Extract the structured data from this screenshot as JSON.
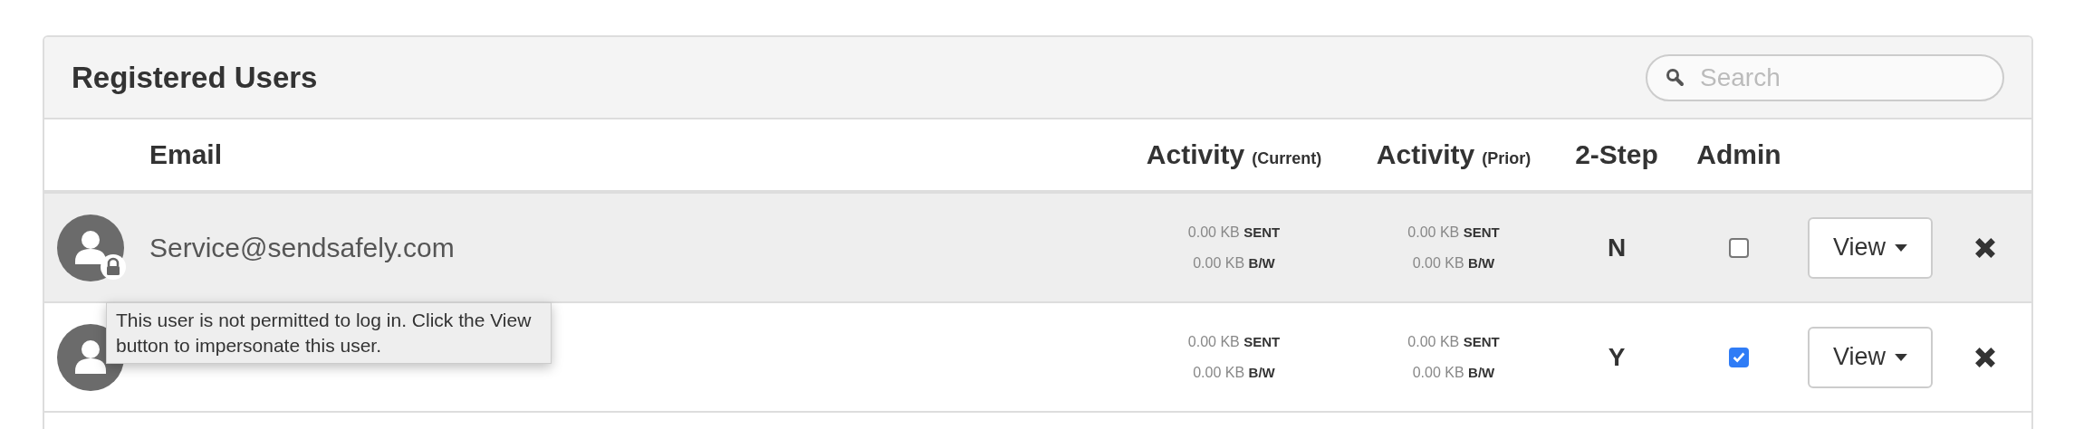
{
  "panel": {
    "title": "Registered Users",
    "search": {
      "placeholder": "Search"
    }
  },
  "columns": [
    {
      "label": "Email"
    },
    {
      "label": "Activity",
      "note": "(Current)"
    },
    {
      "label": "Activity",
      "note": "(Prior)"
    },
    {
      "label": "2-Step"
    },
    {
      "label": "Admin"
    }
  ],
  "users": [
    {
      "email": "Service@sendsafely.com",
      "locked": true,
      "highlighted": true,
      "current": [
        "0.00 KB **SENT**",
        "0.00 KB **B/W**"
      ],
      "prior": [
        "0.00 KB **SENT**",
        "0.00 KB **B/W**"
      ],
      "two_step": "N",
      "admin": false,
      "view_button": "View"
    },
    {
      "locked": false,
      "highlighted": false,
      "current": [
        "0.00 KB **SENT**",
        "0.00 KB **B/W**"
      ],
      "prior": [
        "0.00 KB **SENT**",
        "0.00 KB **B/W**"
      ],
      "two_step": "Y",
      "admin": true,
      "view_button": "View"
    }
  ],
  "tooltip": {
    "text": "This user is not permitted to log in. Click the View button to impersonate this user."
  }
}
